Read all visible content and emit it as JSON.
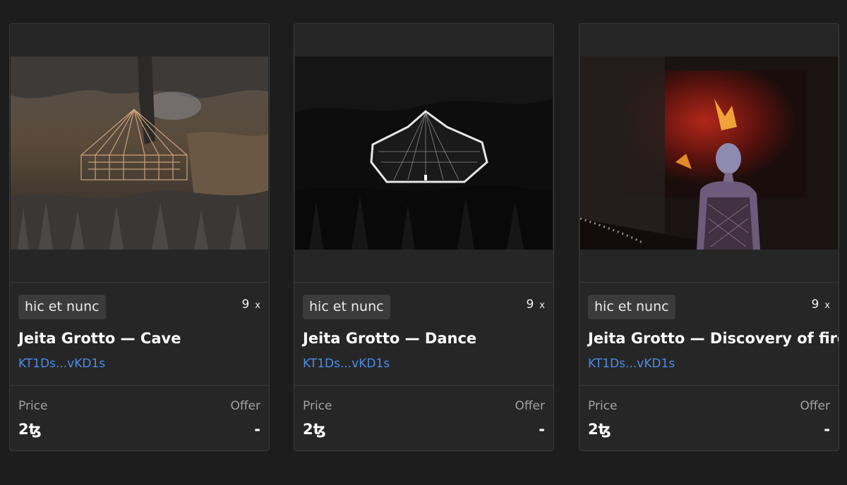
{
  "cards": [
    {
      "platform": "hic et nunc",
      "editions": "9",
      "editions_suffix": "x",
      "title": "Jeita Grotto — Cave",
      "contract": "KT1Ds...vKD1s",
      "price_label": "Price",
      "offer_label": "Offer",
      "price": "2ꜩ",
      "offer": "-"
    },
    {
      "platform": "hic et nunc",
      "editions": "9",
      "editions_suffix": "x",
      "title": "Jeita Grotto — Dance",
      "contract": "KT1Ds...vKD1s",
      "price_label": "Price",
      "offer_label": "Offer",
      "price": "2ꜩ",
      "offer": "-"
    },
    {
      "platform": "hic et nunc",
      "editions": "9",
      "editions_suffix": "x",
      "title": "Jeita Grotto — Discovery of fire",
      "contract": "KT1Ds...vKD1s",
      "price_label": "Price",
      "offer_label": "Offer",
      "price": "2ꜩ",
      "offer": "-"
    }
  ],
  "colors": {
    "background": "#1d1d1d",
    "card": "#262626",
    "border": "#3a3a3a",
    "badge": "#3b3b3b",
    "link": "#4b8ce6",
    "muted": "#a2a2a2"
  }
}
